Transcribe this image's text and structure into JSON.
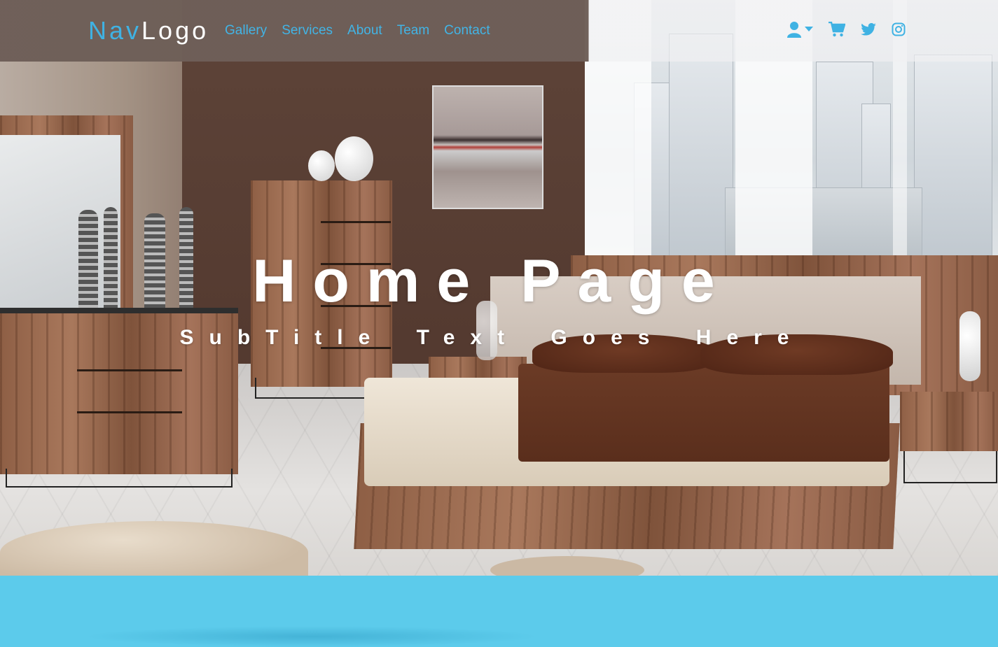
{
  "navbar": {
    "logo_nav": "Nav",
    "logo_rest": "Logo",
    "links": [
      "Gallery",
      "Services",
      "About",
      "Team",
      "Contact"
    ],
    "icons": [
      "user-icon",
      "caret-down-icon",
      "cart-icon",
      "twitter-icon",
      "instagram-icon"
    ],
    "accent_color": "#3fb2e3"
  },
  "hero": {
    "title": "Home Page",
    "subtitle": "SubTitle Text Goes Here",
    "background": "bedroom-photo"
  },
  "band": {
    "color": "#5ccbeb"
  }
}
